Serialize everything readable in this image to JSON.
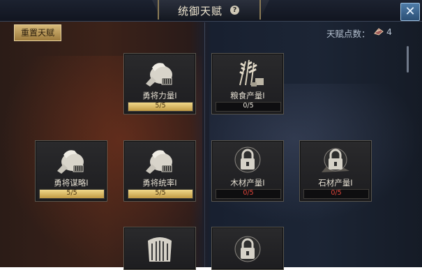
{
  "header": {
    "title": "统御天赋",
    "help_icon": "question-mark-icon",
    "close_icon": "close-x-icon"
  },
  "toolbar": {
    "reset_label": "重置天赋"
  },
  "points": {
    "label": "天赋点数：",
    "icon": "talent-book-icon",
    "value": "4"
  },
  "talents": [
    {
      "name": "勇将力量Ⅰ",
      "progress": "5/5",
      "fill": 1.0,
      "state": "maxed",
      "icon": "war-horse-icon"
    },
    {
      "name": "粮食产量Ⅰ",
      "progress": "0/5",
      "fill": 0.0,
      "state": "available",
      "icon": "wheat-icon"
    },
    {
      "name": "勇将谋略Ⅰ",
      "progress": "5/5",
      "fill": 1.0,
      "state": "maxed",
      "icon": "war-horse-icon"
    },
    {
      "name": "勇将统率Ⅰ",
      "progress": "5/5",
      "fill": 1.0,
      "state": "maxed",
      "icon": "war-horse-icon"
    },
    {
      "name": "木材产量Ⅰ",
      "progress": "0/5",
      "fill": 0.0,
      "state": "locked",
      "icon": "lock-icon"
    },
    {
      "name": "石材产量Ⅰ",
      "progress": "0/5",
      "fill": 0.0,
      "state": "locked",
      "icon": "lock-icon"
    },
    {
      "icon": "armor-chest-icon",
      "state": "partial"
    },
    {
      "icon": "lock-icon",
      "state": "partial"
    }
  ]
}
